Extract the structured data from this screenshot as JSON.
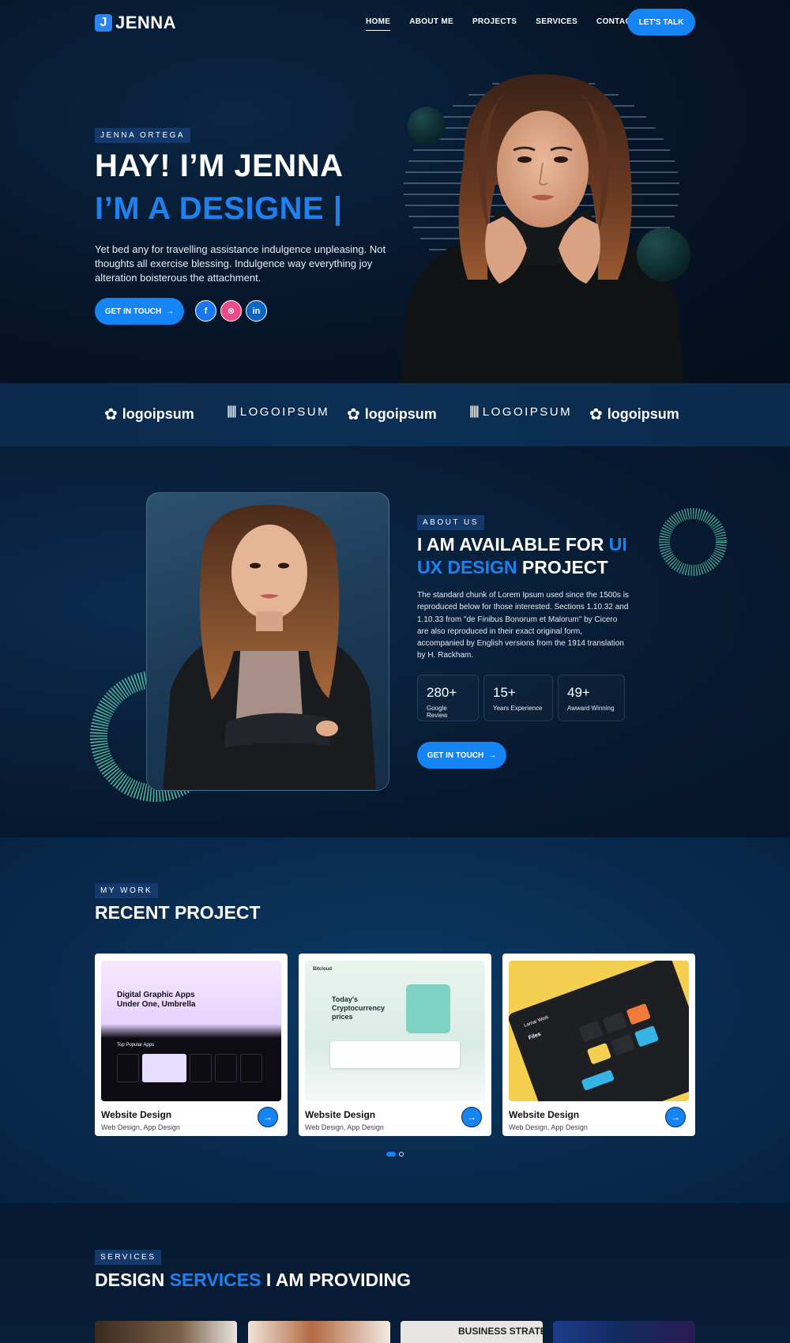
{
  "header": {
    "logo_mark": "J",
    "logo_text": "JENNA",
    "nav": [
      "HOME",
      "ABOUT ME",
      "PROJECTS",
      "SERVICES",
      "CONTACT"
    ],
    "active_nav": "HOME",
    "cta": "LET'S TALK"
  },
  "hero": {
    "tag": "JENNA ORTEGA",
    "title": "HAY! I’M JENNA",
    "subtitle": "I’M A DESIGNE |",
    "description": "Yet bed any for travelling assistance indulgence unpleasing. Not thoughts all exercise blessing. Indulgence way everything joy alteration boisterous the attachment.",
    "cta": "GET IN TOUCH",
    "socials": [
      {
        "icon": "facebook-icon",
        "glyph": "f"
      },
      {
        "icon": "dribbble-icon",
        "glyph": "⊛"
      },
      {
        "icon": "linkedin-icon",
        "glyph": "in"
      }
    ]
  },
  "logos": [
    {
      "text": "logoipsum",
      "style": "bold"
    },
    {
      "text": "LOGOIPSUM",
      "style": "light"
    },
    {
      "text": "logoipsum",
      "style": "bold"
    },
    {
      "text": "LOGOIPSUM",
      "style": "light"
    },
    {
      "text": "logoipsum",
      "style": "bold"
    }
  ],
  "about": {
    "tag": "ABOUT US",
    "title_part1": "I AM AVAILABLE FOR ",
    "title_highlight": "UI UX DESIGN",
    "title_part2": " PROJECT",
    "description": "The standard chunk of Lorem Ipsum used since the 1500s is reproduced below for those interested. Sections 1.10.32 and 1.10.33 from \"de Finibus Bonorum et Malorum\" by Cicero are also reproduced in their exact original form, accompanied by English versions from the 1914 translation by H. Rackham.",
    "stats": [
      {
        "value": "280+",
        "label": "Google Review"
      },
      {
        "value": "15+",
        "label": "Years Experience"
      },
      {
        "value": "49+",
        "label": "Awward Winning"
      }
    ],
    "cta": "GET IN TOUCH"
  },
  "projects": {
    "tag": "MY WORK",
    "title": "RECENT PROJECT",
    "cards": [
      {
        "title": "Website Design",
        "subtitle": "Web Design, App Design",
        "shot_heading": "Digital Graphic Apps Under One, Umbrella",
        "shot_caption": "Top Popular Apps"
      },
      {
        "title": "Website Design",
        "subtitle": "Web Design, App Design",
        "shot_heading": "Today's Cryptocurrency prices",
        "shot_caption": "Bitcloud"
      },
      {
        "title": "Website Design",
        "subtitle": "Web Design, App Design",
        "shot_heading": "Files",
        "shot_caption": "Lamar Work"
      }
    ],
    "pagination": {
      "current": 1,
      "total": 2
    }
  },
  "services": {
    "tag": "SERVICES",
    "title_part1": "DESIGN ",
    "title_highlight": "SERVICES",
    "title_part2": " I AM PROVIDING",
    "thumb_caption": "BUSINESS STRATEG"
  },
  "colors": {
    "accent": "#1585f5",
    "highlight_text": "#1d82f0",
    "tag_bg": "#15396a",
    "ring": "#5fd1b0"
  }
}
